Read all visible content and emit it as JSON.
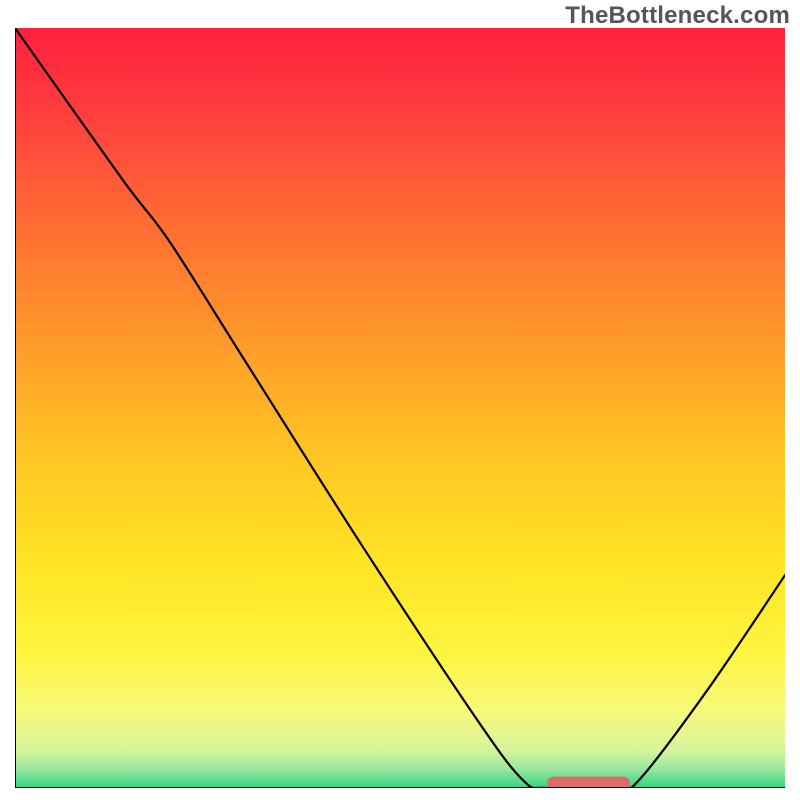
{
  "watermark": "TheBottleneck.com",
  "chart_data": {
    "type": "line",
    "title": "",
    "xlabel": "",
    "ylabel": "",
    "xlim": [
      0,
      100
    ],
    "ylim": [
      0,
      100
    ],
    "grid": false,
    "legend": false,
    "background_gradient_stops": [
      {
        "offset": 0.0,
        "color": "#ff203e"
      },
      {
        "offset": 0.1,
        "color": "#ff3b3f"
      },
      {
        "offset": 0.25,
        "color": "#ff6a33"
      },
      {
        "offset": 0.4,
        "color": "#ff962b"
      },
      {
        "offset": 0.55,
        "color": "#ffc224"
      },
      {
        "offset": 0.7,
        "color": "#ffe324"
      },
      {
        "offset": 0.82,
        "color": "#fff43e"
      },
      {
        "offset": 0.9,
        "color": "#f7f97a"
      },
      {
        "offset": 0.95,
        "color": "#d7f39a"
      },
      {
        "offset": 0.975,
        "color": "#9ae8a1"
      },
      {
        "offset": 0.99,
        "color": "#5bdc8f"
      },
      {
        "offset": 1.0,
        "color": "#2fd47f"
      }
    ],
    "series": [
      {
        "name": "bottleneck-curve",
        "color": "#000000",
        "width": 2.2,
        "points": [
          {
            "x": 0,
            "y": 100
          },
          {
            "x": 14,
            "y": 80
          },
          {
            "x": 20,
            "y": 72
          },
          {
            "x": 30,
            "y": 56
          },
          {
            "x": 45,
            "y": 32
          },
          {
            "x": 60,
            "y": 9
          },
          {
            "x": 66,
            "y": 1
          },
          {
            "x": 69,
            "y": 0
          },
          {
            "x": 78,
            "y": 0
          },
          {
            "x": 81,
            "y": 1
          },
          {
            "x": 90,
            "y": 13
          },
          {
            "x": 100,
            "y": 28
          }
        ]
      }
    ],
    "marker": {
      "name": "optimal-zone",
      "color": "#e06a6a",
      "x_start": 70,
      "x_end": 79,
      "y": 0.6,
      "thickness": 1.8,
      "cap": "round"
    },
    "axes": {
      "color": "#000000",
      "width": 2
    }
  }
}
